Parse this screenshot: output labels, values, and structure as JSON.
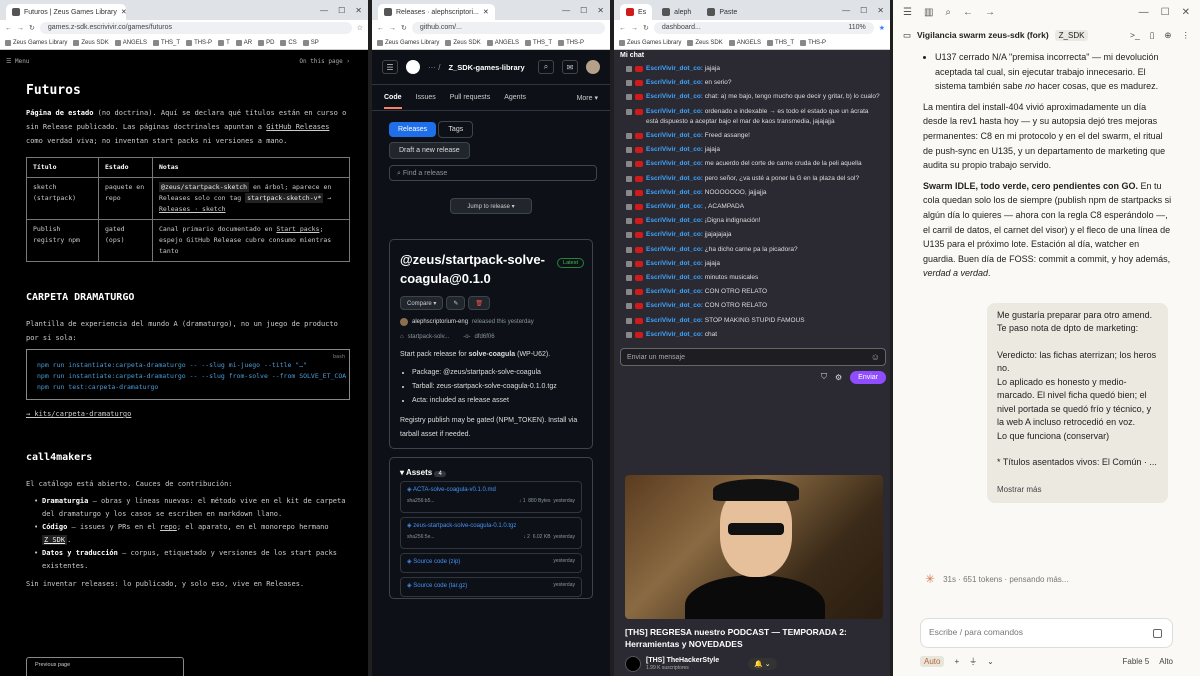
{
  "w1": {
    "tab": "Futuros | Zeus Games Library",
    "url": "games.z-sdk.escrivivir.co/games/futuros",
    "bookmarks": [
      "Zeus Games Library",
      "Zeus SDK",
      "ANGELS",
      "THS_T",
      "THS-P",
      "T",
      "AR",
      "PD",
      "CS",
      "SP"
    ],
    "menu": "☰ Menu",
    "on_this_page": "On this page ›",
    "h1": "Futuros",
    "intro_bold": "Página de estado",
    "intro_1": " (no doctrina). Aquí se declara qué títulos están en curso o sin Release publicado. Las páginas doctrinales apuntan a ",
    "intro_link": "GitHub Releases",
    "intro_2": " como verdad viva; no inventan start packs ni versiones a mano.",
    "table": {
      "headers": [
        "Título",
        "Estado",
        "Notas"
      ],
      "rows": [
        {
          "titulo": "sketch (startpack)",
          "estado": "paquete en repo",
          "code1": "@zeus/startpack-sketch",
          "notas_1": " en árbol; aparece en Releases solo con tag ",
          "code2": "startpack-sketch-v*",
          "notas_2": " → ",
          "link": "Releases · sketch"
        },
        {
          "titulo": "Publish registry npm",
          "estado": "gated (ops)",
          "notas_a": "Canal primario documentado en ",
          "link": "Start packs",
          "notas_b": "; espejo GitHub Release cubre consumo mientras tanto"
        }
      ]
    },
    "sec2": "CARPETA DRAMATURGO",
    "sec2_text": "Plantilla de experiencia del mundo A (dramaturgo), no un juego de producto por sí sola:",
    "code_lang": "bash",
    "code_lines": [
      "npm run instantiate:carpeta-dramaturgo -- --slug mi-juego --title \"…\"",
      "npm run instantiate:carpeta-dramaturgo -- --slug from-solve --from SOLVE_ET_COA",
      "npm run test:carpeta-dramaturgo"
    ],
    "sec2_link": "→ kits/carpeta-dramaturgo",
    "sec3": "call4makers",
    "sec3_text": "El catálogo está abierto. Cauces de contribución:",
    "bullets": [
      {
        "bold": "Dramaturgia",
        "text": " — obras y líneas nuevas: el método vive en el kit de carpeta del dramaturgo y los casos se escriben en markdown llano."
      },
      {
        "bold": "Código",
        "text": " — issues y PRs en el ",
        "link": "repo",
        "text2": "; el aparato, en el monorepo hermano ",
        "code": "Z_SDK",
        "text3": "."
      },
      {
        "bold": "Datos y traducción",
        "text": " — corpus, etiquetado y versiones de los start packs existentes."
      }
    ],
    "closing": "Sin inventar releases: lo publicado, y solo eso, vive en Releases.",
    "prev": "Previous page"
  },
  "w2": {
    "tab": "Releases · alephscriptori...",
    "url": "github.com/...",
    "bookmarks": [
      "Zeus Games Library",
      "Zeus SDK",
      "ANGELS",
      "THS_T",
      "THS-P"
    ],
    "repo": "Z_SDK-games-library",
    "nav": [
      "Code",
      "Issues",
      "Pull requests",
      "Agents",
      "More ▾"
    ],
    "btn_releases": "Releases",
    "btn_tags": "Tags",
    "btn_draft": "Draft a new release",
    "find_placeholder": "Find a release",
    "jump": "Jump to release ▾",
    "release_title": "@zeus/startpack-solve-coagula@0.1.0",
    "latest": "Latest",
    "compare": "Compare ▾",
    "author": "alephscriptorium-eng",
    "released": "released this yesterday",
    "tag": "startpack-solv...",
    "commit": "dfd6f06",
    "desc_a": "Start pack release for ",
    "desc_b": "solve-coagula",
    "desc_c": " (WP-U62).",
    "list": [
      "Package: @zeus/startpack-solve-coagula",
      "Tarball: zeus-startpack-solve-coagula-0.1.0.tgz",
      "Acta: included as release asset"
    ],
    "note": "Registry publish may be gated (NPM_TOKEN). Install via tarball asset if needed.",
    "assets_label": "Assets",
    "assets_count": "4",
    "assets": [
      {
        "name": "ACTA-solve-coagula-v0.1.0.md",
        "sha": "sha256:b5...",
        "dl": "1",
        "size": "880 Bytes",
        "date": "yesterday"
      },
      {
        "name": "zeus-startpack-solve-coagula-0.1.0.tgz",
        "sha": "sha256:5e...",
        "dl": "2",
        "size": "6.02 KB",
        "date": "yesterday"
      },
      {
        "name": "Source code (zip)",
        "date": "yesterday"
      },
      {
        "name": "Source code (tar.gz)",
        "date": "yesterday"
      }
    ]
  },
  "w3": {
    "tabs": [
      "Es",
      "aleph",
      "Paste"
    ],
    "url": "dashboard...",
    "zoom": "110%",
    "bookmarks": [
      "Zeus Games Library",
      "Zeus SDK",
      "ANGELS",
      "THS_T",
      "THS-P"
    ],
    "chat_title": "Mi chat",
    "user": "EscriVivir_dot_co:",
    "messages": [
      "jajaja",
      "en serio?",
      "chat: a) me bajo, tengo mucho que decir y gritar, b) lo cualo?",
      "ordenado e indexable → es todo el estado que un ácrata está dispuesto a aceptar bajo el mar de kaos transmedia, jajajajja",
      "Freed assange!",
      "jajaja",
      "me acuerdo del corte de carne cruda de la peli aquella",
      "pero señor, ¿va usté a poner la G en la plaza del sol?",
      "NOOOOOOO, jajjajja",
      ", ACAMPADA",
      "¡Digna indignación!",
      "jjajajajaja",
      "¿ha dicho carne pa la picadora?",
      "jajaja",
      "minutos musicales",
      "CON OTRO RELATO",
      "CON OTRO RELATO",
      "STOP MAKING STUPID FAMOUS",
      "chat"
    ],
    "input_placeholder": "Enviar un mensaje",
    "send": "Enviar",
    "video_title": "[THS] REGRESA nuestro PODCAST — TEMPORADA 2: Herramientas y NOVEDADES",
    "channel": "[THS] TheHackerStyle",
    "subs": "1.99 K suscriptores"
  },
  "w4": {
    "title": "Vigilancia swarm zeus-sdk (fork)",
    "tag": "Z_SDK",
    "bullet": "U137 cerrado N/A \"premisa incorrecta\" — mi devolución aceptada tal cual, sin ejecutar trabajo innecesario. El sistema también sabe ",
    "bullet_em": "no",
    "bullet_end": " hacer cosas, que es madurez.",
    "p1": "La mentira del install-404 vivió aproximadamente un día desde la rev1 hasta hoy — y su autopsia dejó tres mejoras permanentes: C8 en mi protocolo y en el del swarm, el ritual de push-sync en U135, y un departamento de marketing que audita su propio trabajo servido.",
    "p2_bold": "Swarm IDLE, todo verde, cero pendientes con GO.",
    "p2": " En tu cola quedan solo los de siempre (publish npm de startpacks si algún día lo quieres — ahora con la regla C8 esperándolo —, el carril de datos, el carnet del visor) y el fleco de una línea de U135 para el próximo lote. Estación al día, watcher en guardia. Buen día de FOSS: commit a commit, y hoy además, ",
    "p2_em": "verdad a verdad",
    "p2_end": ".",
    "user_msg": [
      "Me gustaría preparar para otro amend. Te paso nota de dpto de marketing:",
      "",
      "Veredicto: las fichas aterrizan; los heros no.",
      "Lo aplicado es honesto y medio-marcado. El nivel ficha quedó bien; el nivel portada se quedó frío y técnico, y la web A incluso retrocedió en voz.",
      "Lo que funciona (conservar)",
      "",
      "* Títulos asentados vivos: El Común · ..."
    ],
    "show_more": "Mostrar más",
    "thinking": "31s · 651 tokens · pensando más...",
    "composer": "Escribe / para comandos",
    "auto": "Auto",
    "model": "Fable 5",
    "effort": "Alto"
  }
}
